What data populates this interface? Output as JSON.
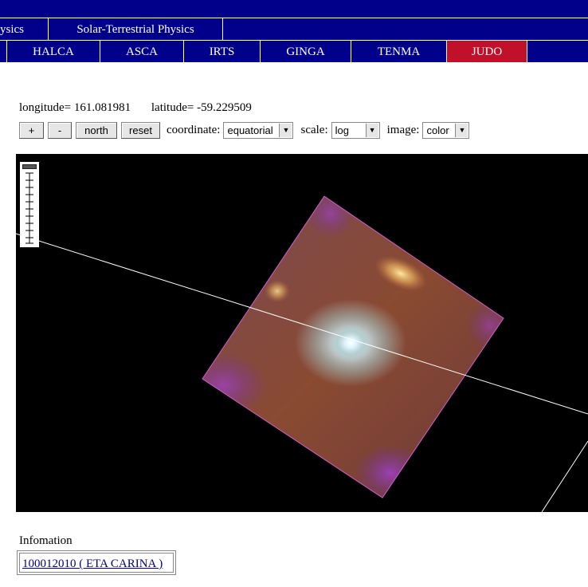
{
  "nav": {
    "row1": [
      "ysics",
      "Solar-Terrestrial Physics"
    ],
    "row2": [
      "HALCA",
      "ASCA",
      "IRTS",
      "GINGA",
      "TENMA",
      "JUDO"
    ],
    "active": "JUDO"
  },
  "coords": {
    "longitude": "longitude= 161.081981",
    "latitude": "latitude= -59.229509"
  },
  "toolbar": {
    "zoom_in": "+",
    "zoom_out": "-",
    "north": "north",
    "reset": "reset",
    "coordinate_label": "coordinate:",
    "coordinate_value": "equatorial",
    "scale_label": "scale:",
    "scale_value": "log",
    "image_label": "image:",
    "image_value": "color"
  },
  "viewer": {
    "background": "#000000",
    "frame_color": "#d45ad4",
    "grid_color": "#ffffff"
  },
  "info": {
    "label": "Infomation",
    "link": "100012010 ( ETA CARINA )"
  },
  "colors": {
    "nav_bg": "#00008b",
    "nav_active": "#c0102a",
    "link": "#00008b"
  }
}
